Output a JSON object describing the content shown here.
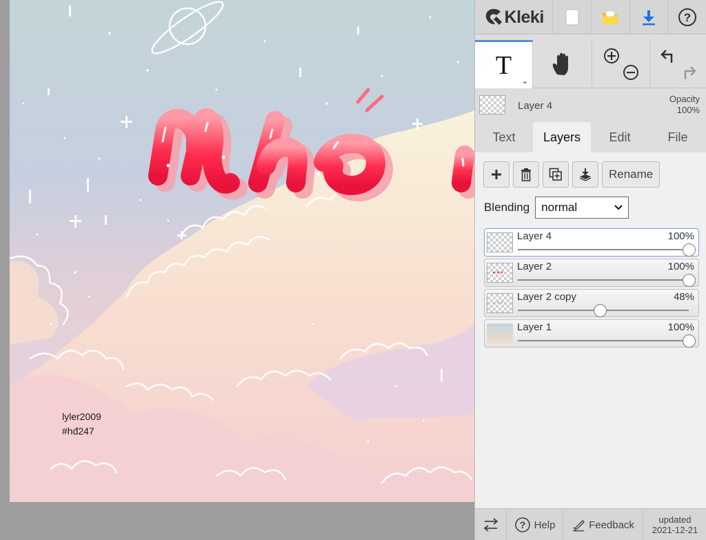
{
  "app": {
    "logo_text": "Kleki"
  },
  "canvas": {
    "signature_line1": "lyler2009",
    "signature_line2": "#hđ247"
  },
  "topbar": {
    "icons": [
      "new-image-icon",
      "open-folder-icon",
      "download-icon",
      "help-icon"
    ],
    "colors": {
      "folder": "#f5c400",
      "download": "#1a73e8"
    }
  },
  "tools": {
    "text_tool": "T"
  },
  "current_layer": {
    "name": "Layer 4",
    "opacity_label": "Opacity",
    "opacity_value": "100%"
  },
  "tabs": [
    {
      "label": "Text",
      "active": false
    },
    {
      "label": "Layers",
      "active": true
    },
    {
      "label": "Edit",
      "active": false
    },
    {
      "label": "File",
      "active": false
    }
  ],
  "layer_toolbar": {
    "rename_label": "Rename"
  },
  "blending": {
    "label": "Blending",
    "value": "normal"
  },
  "layers": [
    {
      "name": "Layer 4",
      "opacity": "100%",
      "opacity_fraction": 1.0,
      "selected": true
    },
    {
      "name": "Layer 2",
      "opacity": "100%",
      "opacity_fraction": 1.0,
      "selected": false
    },
    {
      "name": "Layer 2 copy",
      "opacity": "48%",
      "opacity_fraction": 0.48,
      "selected": false
    },
    {
      "name": "Layer 1",
      "opacity": "100%",
      "opacity_fraction": 1.0,
      "selected": false
    }
  ],
  "bottombar": {
    "help_label": "Help",
    "feedback_label": "Feedback",
    "updated_label": "updated",
    "updated_date": "2021-12-21"
  },
  "accent": "#5a8ad4"
}
